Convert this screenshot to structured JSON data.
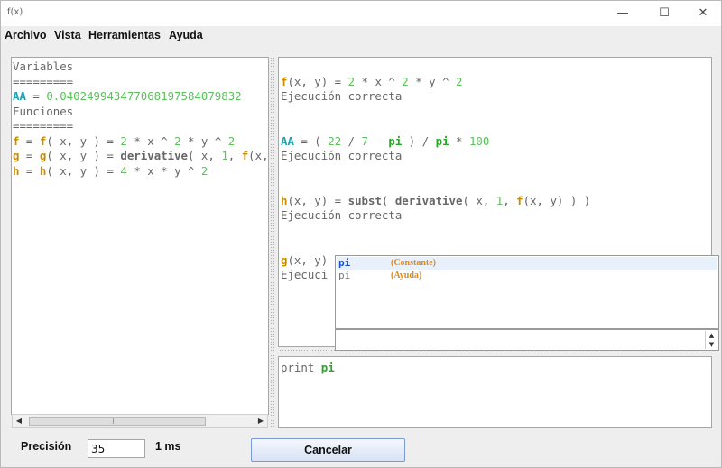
{
  "window": {
    "title": "f(x)",
    "controls": {
      "minimize": "—",
      "maximize": "☐",
      "close": "✕"
    }
  },
  "menu": [
    "Archivo",
    "Vista",
    "Herramientas",
    "Ayuda"
  ],
  "left_panel": {
    "lines": [
      [
        {
          "t": "Variables",
          "c": "t-gray"
        }
      ],
      [
        {
          "t": "=========",
          "c": "t-gray"
        }
      ],
      [
        {
          "t": "AA",
          "c": "k-cyan"
        },
        {
          "t": " = ",
          "c": "t-gray"
        },
        {
          "t": "0.040249943477068197584079832",
          "c": "n-green"
        }
      ],
      [
        {
          "t": "Funciones",
          "c": "t-gray"
        }
      ],
      [
        {
          "t": "=========",
          "c": "t-gray"
        }
      ],
      [
        {
          "t": "f",
          "c": "k-orange"
        },
        {
          "t": " = ",
          "c": "t-gray"
        },
        {
          "t": "f",
          "c": "k-orange"
        },
        {
          "t": "( x, y ) = ",
          "c": "t-gray"
        },
        {
          "t": "2",
          "c": "n-green"
        },
        {
          "t": " * x ^ ",
          "c": "t-gray"
        },
        {
          "t": "2",
          "c": "n-green"
        },
        {
          "t": " * y ^ ",
          "c": "t-gray"
        },
        {
          "t": "2",
          "c": "n-green"
        }
      ],
      [
        {
          "t": "g",
          "c": "k-orange"
        },
        {
          "t": " = ",
          "c": "t-gray"
        },
        {
          "t": "g",
          "c": "k-orange"
        },
        {
          "t": "( x, y ) = ",
          "c": "t-gray"
        },
        {
          "t": "derivative",
          "c": "k-gray-b"
        },
        {
          "t": "( x, ",
          "c": "t-gray"
        },
        {
          "t": "1",
          "c": "n-green"
        },
        {
          "t": ", ",
          "c": "t-gray"
        },
        {
          "t": "f",
          "c": "k-orange"
        },
        {
          "t": "(x, y) )",
          "c": "t-gray"
        }
      ],
      [
        {
          "t": "h",
          "c": "k-orange"
        },
        {
          "t": " = ",
          "c": "t-gray"
        },
        {
          "t": "h",
          "c": "k-orange"
        },
        {
          "t": "( x, y ) = ",
          "c": "t-gray"
        },
        {
          "t": "4",
          "c": "n-green"
        },
        {
          "t": " * x * y ^ ",
          "c": "t-gray"
        },
        {
          "t": "2",
          "c": "n-green"
        }
      ]
    ]
  },
  "output_panel": {
    "lines": [
      [],
      [
        {
          "t": "f",
          "c": "k-orange"
        },
        {
          "t": "(x, y) = ",
          "c": "t-gray"
        },
        {
          "t": "2",
          "c": "n-green"
        },
        {
          "t": " * x ^ ",
          "c": "t-gray"
        },
        {
          "t": "2",
          "c": "n-green"
        },
        {
          "t": " * y ^ ",
          "c": "t-gray"
        },
        {
          "t": "2",
          "c": "n-green"
        }
      ],
      [
        {
          "t": "Ejecución correcta",
          "c": "t-gray"
        }
      ],
      [],
      [],
      [
        {
          "t": "AA",
          "c": "k-cyan"
        },
        {
          "t": " = ( ",
          "c": "t-gray"
        },
        {
          "t": "22",
          "c": "n-green"
        },
        {
          "t": " / ",
          "c": "t-gray"
        },
        {
          "t": "7",
          "c": "n-green"
        },
        {
          "t": " - ",
          "c": "t-gray"
        },
        {
          "t": "pi",
          "c": "k-green"
        },
        {
          "t": " ) / ",
          "c": "t-gray"
        },
        {
          "t": "pi",
          "c": "k-green"
        },
        {
          "t": " * ",
          "c": "t-gray"
        },
        {
          "t": "100",
          "c": "n-green"
        }
      ],
      [
        {
          "t": "Ejecución correcta",
          "c": "t-gray"
        }
      ],
      [],
      [],
      [
        {
          "t": "h",
          "c": "k-orange"
        },
        {
          "t": "(x, y) = ",
          "c": "t-gray"
        },
        {
          "t": "subst",
          "c": "k-gray-b"
        },
        {
          "t": "( ",
          "c": "t-gray"
        },
        {
          "t": "derivative",
          "c": "k-gray-b"
        },
        {
          "t": "( x, ",
          "c": "t-gray"
        },
        {
          "t": "1",
          "c": "n-green"
        },
        {
          "t": ", ",
          "c": "t-gray"
        },
        {
          "t": "f",
          "c": "k-orange"
        },
        {
          "t": "(x, y) ) )",
          "c": "t-gray"
        }
      ],
      [
        {
          "t": "Ejecución correcta",
          "c": "t-gray"
        }
      ],
      [],
      [],
      [
        {
          "t": "g",
          "c": "k-orange"
        },
        {
          "t": "(x, y)",
          "c": "t-gray"
        }
      ],
      [
        {
          "t": "Ejecuci",
          "c": "t-gray"
        }
      ]
    ]
  },
  "autocomplete": {
    "items": [
      {
        "name": "pi",
        "type": "(Constante)",
        "selected": true
      },
      {
        "name": "pi",
        "type": "(Ayuda)",
        "selected": false
      }
    ],
    "field_value": "",
    "spin_up": "▲",
    "spin_down": "▼"
  },
  "input_panel": {
    "lines": [
      [
        {
          "t": "print ",
          "c": "t-gray"
        },
        {
          "t": "pi",
          "c": "k-green"
        }
      ]
    ]
  },
  "scrollbar": {
    "left_arrow": "◀",
    "right_arrow": "▶"
  },
  "bottom": {
    "precision_label": "Precisión",
    "precision_value": "35",
    "time_label": "1 ms",
    "cancel_label": "Cancelar"
  }
}
